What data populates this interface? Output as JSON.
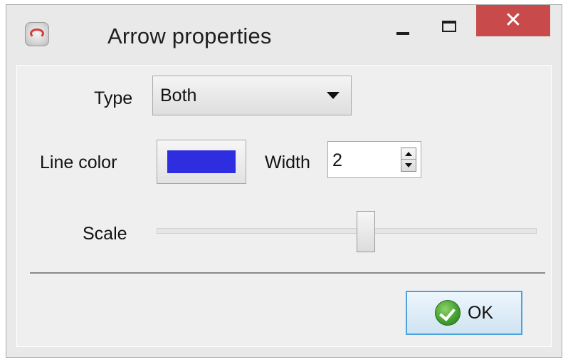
{
  "window": {
    "title": "Arrow properties",
    "icons": {
      "app": "arrow-app-icon",
      "minimize": "minimize-icon",
      "maximize": "maximize-icon",
      "close": "close-icon"
    },
    "close_glyph": "✕",
    "close_color": "#c94a4a"
  },
  "form": {
    "type": {
      "label": "Type",
      "value": "Both"
    },
    "line_color": {
      "label": "Line color",
      "color": "#2e2ee0"
    },
    "width": {
      "label": "Width",
      "value": "2"
    },
    "scale": {
      "label": "Scale",
      "value_fraction": 0.55
    }
  },
  "footer": {
    "ok_label": "OK",
    "ok_icon": "check-circle-icon"
  }
}
